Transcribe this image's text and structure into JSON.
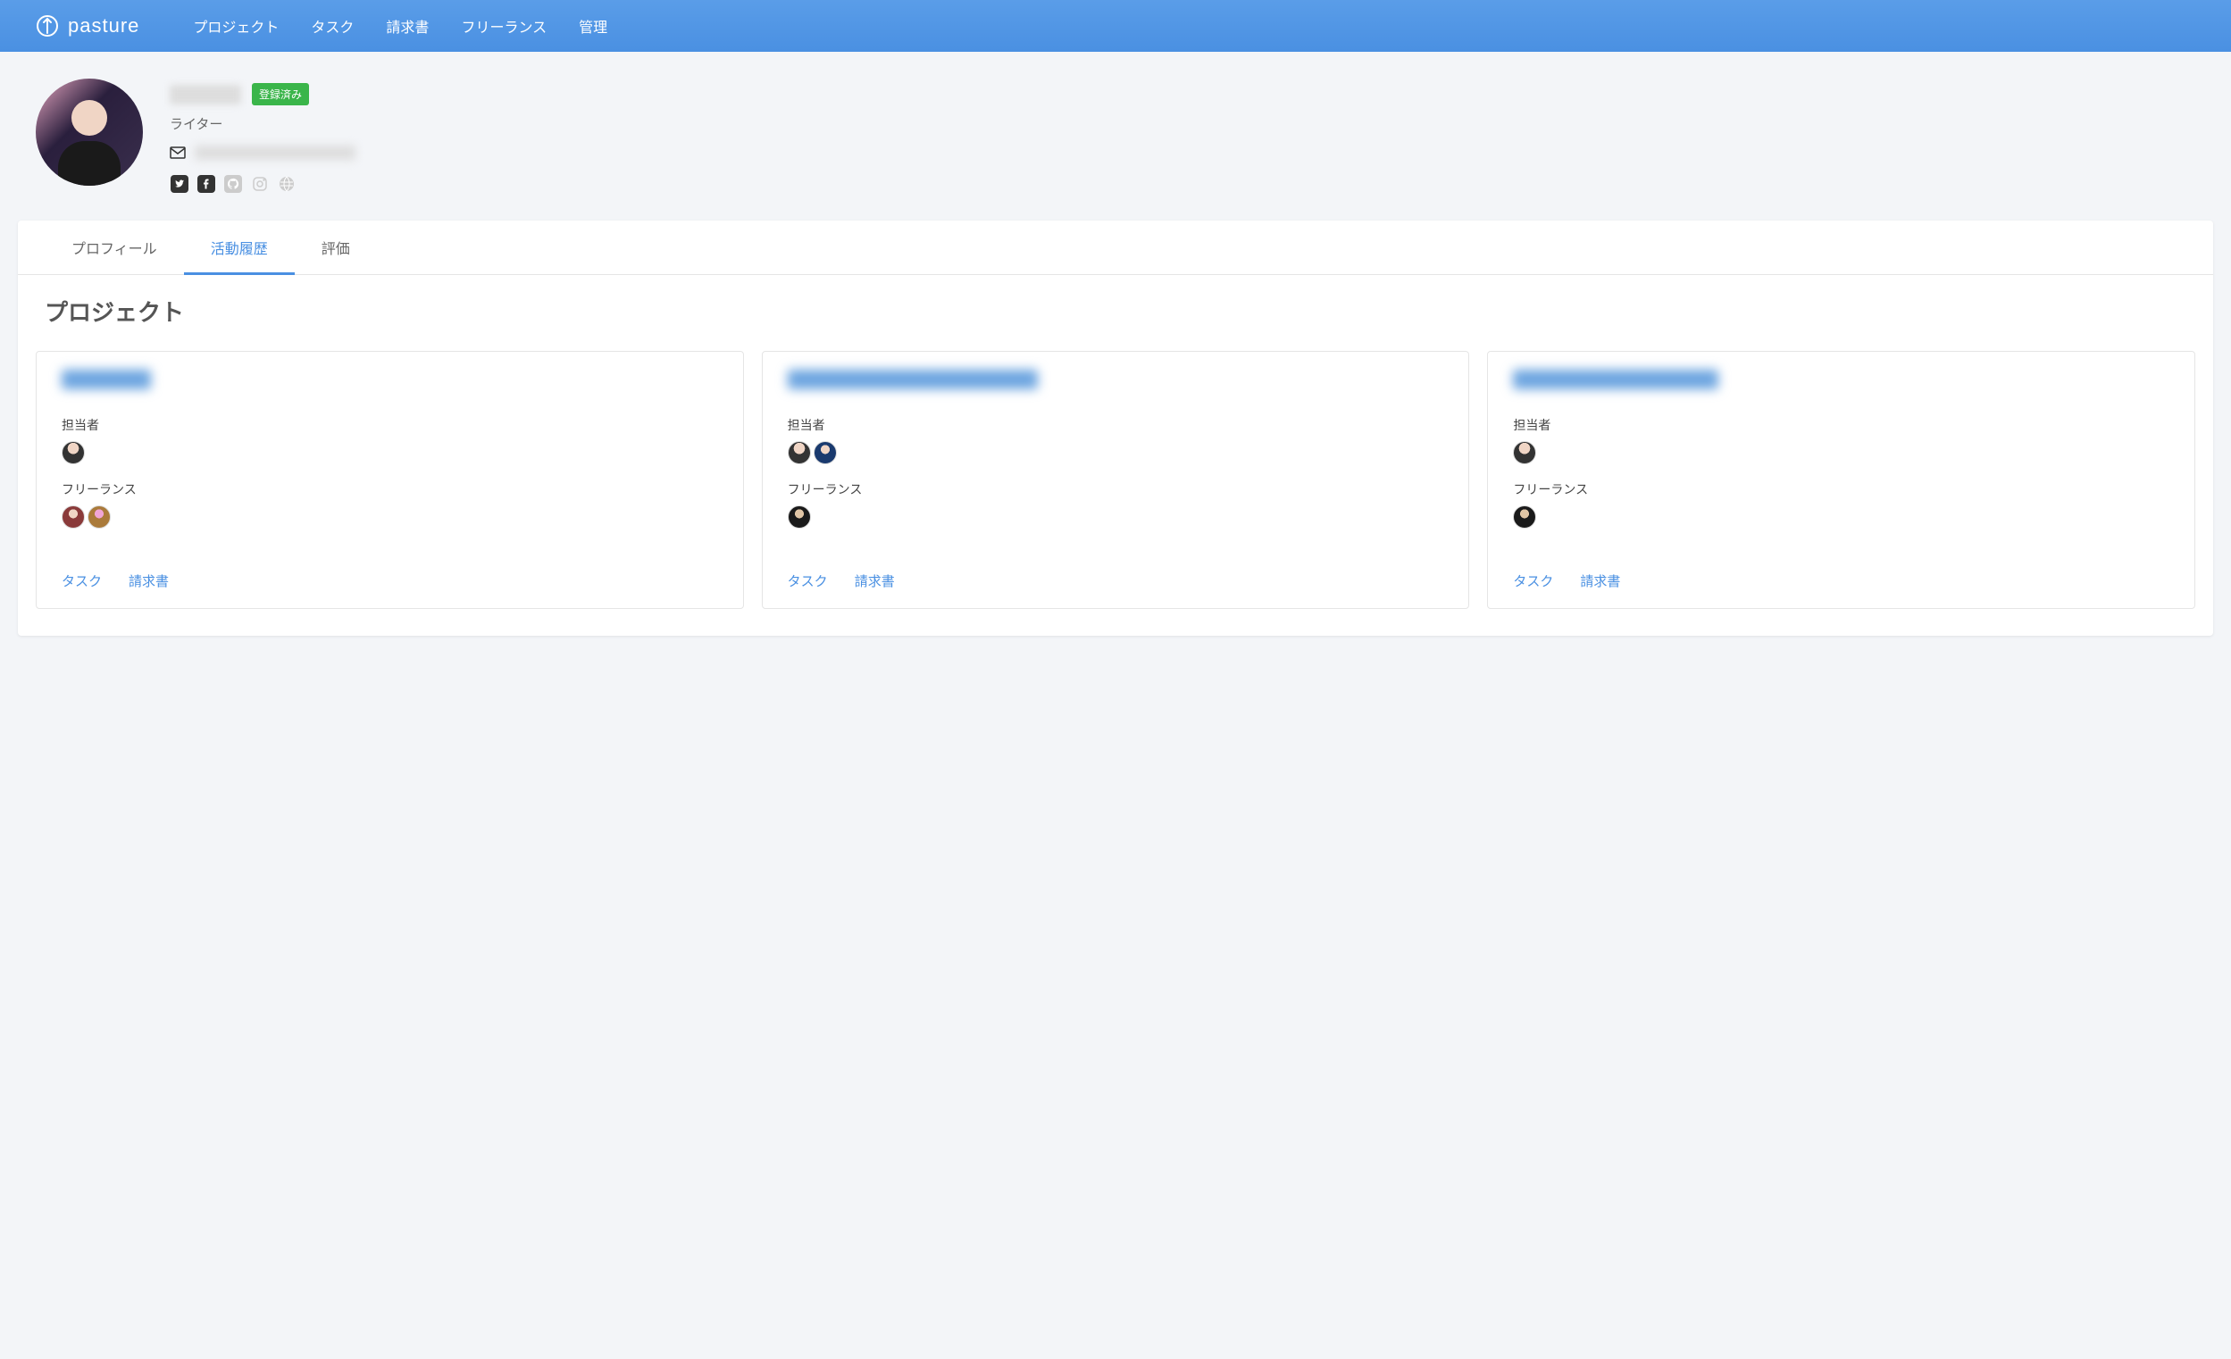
{
  "header": {
    "brand": "pasture",
    "nav": [
      "プロジェクト",
      "タスク",
      "請求書",
      "フリーランス",
      "管理"
    ]
  },
  "profile": {
    "badge": "登録済み",
    "role": "ライター",
    "socials": [
      "twitter",
      "facebook",
      "github",
      "instagram",
      "globe"
    ]
  },
  "tabs": [
    {
      "label": "プロフィール",
      "active": false
    },
    {
      "label": "活動履歴",
      "active": true
    },
    {
      "label": "評価",
      "active": false
    }
  ],
  "section": {
    "title": "プロジェクト"
  },
  "cards": [
    {
      "assignee_label": "担当者",
      "freelance_label": "フリーランス",
      "assignee_count": 1,
      "freelance_count": 2,
      "actions": {
        "task": "タスク",
        "invoice": "請求書"
      }
    },
    {
      "assignee_label": "担当者",
      "freelance_label": "フリーランス",
      "assignee_count": 2,
      "freelance_count": 1,
      "actions": {
        "task": "タスク",
        "invoice": "請求書"
      }
    },
    {
      "assignee_label": "担当者",
      "freelance_label": "フリーランス",
      "assignee_count": 1,
      "freelance_count": 1,
      "actions": {
        "task": "タスク",
        "invoice": "請求書"
      }
    }
  ]
}
